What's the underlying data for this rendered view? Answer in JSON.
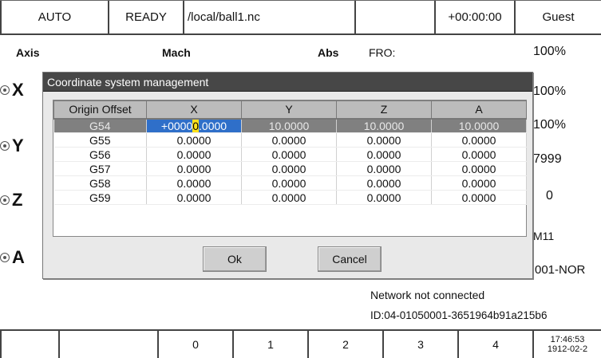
{
  "topbar": {
    "mode": "AUTO",
    "state": "READY",
    "file_path": "/local/ball1.nc",
    "empty": "",
    "elapsed": "+00:00:00",
    "user": "Guest"
  },
  "header": {
    "axis_label": "Axis",
    "mach_label": "Mach",
    "abs_label": "Abs",
    "fro_label": "FRO:"
  },
  "axes": [
    "X",
    "Y",
    "Z",
    "A"
  ],
  "right_panel": {
    "values": [
      "100%",
      "100%",
      "100%",
      "7999",
      "0",
      "M11",
      "001-NOR"
    ]
  },
  "network_status": "Network not connected",
  "device_id": "ID:04-01050001-3651964b91a215b6",
  "softkeys": [
    "",
    "",
    "0",
    "1",
    "2",
    "3",
    "4"
  ],
  "clock": {
    "time": "17:46:53",
    "date": "1912-02-2"
  },
  "dialog": {
    "title": "Coordinate system management",
    "columns": [
      "Origin Offset",
      "X",
      "Y",
      "Z",
      "A"
    ],
    "selected_row": {
      "name": "G54",
      "x_before": "+0000",
      "x_cursor": "0",
      "x_after": ".0000",
      "y": "10.0000",
      "z": "10.0000",
      "a": "10.0000"
    },
    "rows": [
      {
        "name": "G55",
        "x": "0.0000",
        "y": "0.0000",
        "z": "0.0000",
        "a": "0.0000"
      },
      {
        "name": "G56",
        "x": "0.0000",
        "y": "0.0000",
        "z": "0.0000",
        "a": "0.0000"
      },
      {
        "name": "G57",
        "x": "0.0000",
        "y": "0.0000",
        "z": "0.0000",
        "a": "0.0000"
      },
      {
        "name": "G58",
        "x": "0.0000",
        "y": "0.0000",
        "z": "0.0000",
        "a": "0.0000"
      },
      {
        "name": "G59",
        "x": "0.0000",
        "y": "0.0000",
        "z": "0.0000",
        "a": "0.0000"
      }
    ],
    "ok_label": "Ok",
    "cancel_label": "Cancel"
  },
  "colors": {
    "dialog_title_bg": "#474747",
    "selected_row_bg": "#808080",
    "active_cell_bg": "#2f6fc9",
    "edit_cursor": "#ffe21a"
  }
}
